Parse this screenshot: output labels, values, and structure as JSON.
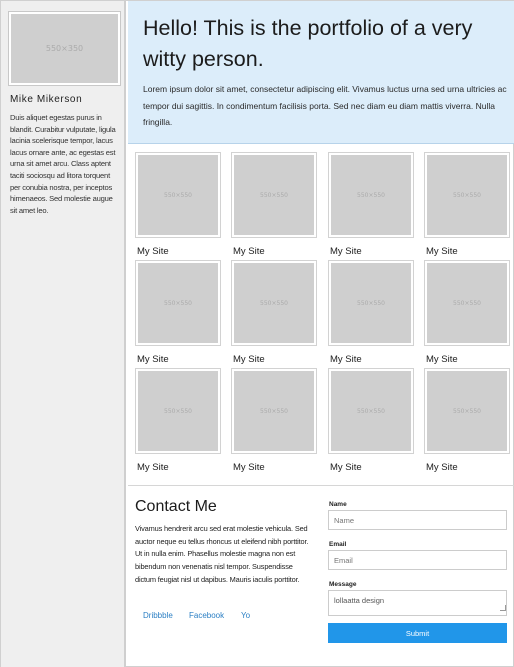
{
  "sidebar": {
    "avatar_placeholder": "550×350",
    "name": "Mike Mikerson",
    "bio": "Duis aliquet egestas purus in blandit. Curabitur vulputate, ligula lacinia scelerisque tempor, lacus lacus ornare ante, ac egestas est urna sit amet arcu. Class aptent taciti sociosqu ad litora torquent per conubia nostra, per inceptos himenaeos. Sed molestie augue sit amet leo."
  },
  "hero": {
    "title": "Hello! This is the portfolio of a very witty person.",
    "text": "Lorem ipsum dolor sit amet, consectetur adipiscing elit. Vivamus luctus urna sed urna ultricies ac tempor dui sagittis. In condimentum facilisis porta. Sed nec diam eu diam mattis viverra. Nulla fringilla."
  },
  "portfolio": {
    "placeholder": "550×550",
    "items": [
      {
        "label": "My Site"
      },
      {
        "label": "My Site"
      },
      {
        "label": "My Site"
      },
      {
        "label": "My Site"
      },
      {
        "label": "My Site"
      },
      {
        "label": "My Site"
      },
      {
        "label": "My Site"
      },
      {
        "label": "My Site"
      },
      {
        "label": "My Site"
      },
      {
        "label": "My Site"
      },
      {
        "label": "My Site"
      },
      {
        "label": "My Site"
      }
    ]
  },
  "contact": {
    "title": "Contact Me",
    "text": "Vivamus hendrerit arcu sed erat molestie vehicula. Sed auctor neque eu tellus rhoncus ut eleifend nibh porttitor. Ut in nulla enim. Phasellus molestie magna non est bibendum non venenatis nisl tempor. Suspendisse dictum feugiat nisl ut dapibus. Mauris iaculis porttitor.",
    "links": {
      "dribbble": "Dribbble",
      "facebook": "Facebook",
      "yo": "Yo"
    },
    "form": {
      "name_label": "Name",
      "name_placeholder": "Name",
      "email_label": "Email",
      "email_placeholder": "Email",
      "message_label": "Message",
      "message_value": "lollaatta design",
      "submit_label": "Submit"
    }
  }
}
